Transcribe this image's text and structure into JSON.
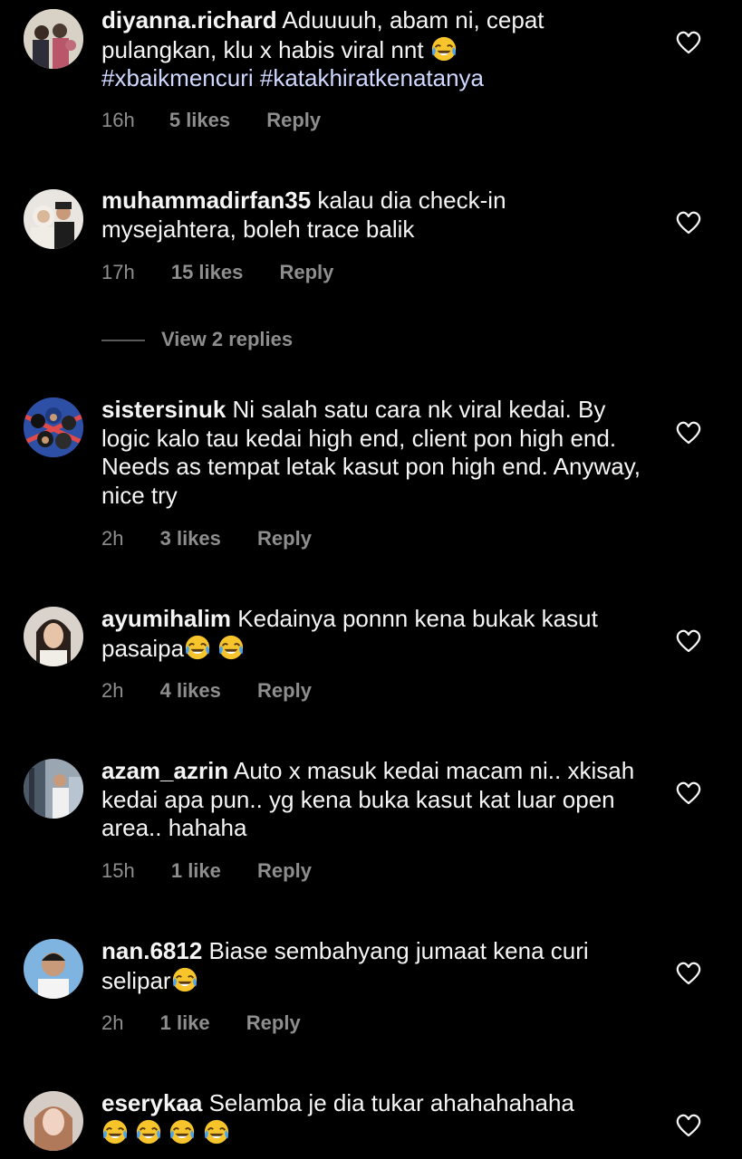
{
  "comments": [
    {
      "username": "diyanna.richard",
      "text": "Aduuuuh, abam ni, cepat pulangkan, klu x habis viral nnt",
      "emoji_count": 1,
      "hashtags": "#xbaikmencuri #katakhiratkenatanya",
      "time": "16h",
      "likes": "5 likes",
      "reply": "Reply"
    },
    {
      "username": "muhammadirfan35",
      "text": "kalau dia check-in mysejahtera, boleh trace balik",
      "time": "17h",
      "likes": "15 likes",
      "reply": "Reply"
    },
    {
      "username": "sistersinuk",
      "text": "Ni salah satu cara nk viral kedai. By logic kalo tau kedai high end, client pon high end. Needs as tempat letak kasut pon high end. Anyway, nice try",
      "time": "2h",
      "likes": "3 likes",
      "reply": "Reply"
    },
    {
      "username": "ayumihalim",
      "text": "Kedainya ponnn kena bukak kasut pasaipa",
      "time": "2h",
      "likes": "4 likes",
      "reply": "Reply"
    },
    {
      "username": "azam_azrin",
      "text": "Auto x masuk kedai macam ni.. xkisah kedai apa pun.. yg kena buka kasut kat luar open area.. hahaha",
      "time": "15h",
      "likes": "1 like",
      "reply": "Reply"
    },
    {
      "username": "nan.6812",
      "text": "Biase sembahyang jumaat kena curi selipar",
      "time": "2h",
      "likes": "1 like",
      "reply": "Reply"
    },
    {
      "username": "eserykaa",
      "text": "Selamba je dia tukar ahahahahaha",
      "time": "",
      "likes": "",
      "reply": ""
    }
  ],
  "view_replies": "View 2 replies",
  "icons": {
    "like": "heart-outline-icon",
    "emoji": "face-with-tears-of-joy"
  },
  "colors": {
    "background": "#000000",
    "text": "#f5f5f5",
    "meta": "#8e8e8e",
    "hashtag": "#cfd8ff"
  }
}
